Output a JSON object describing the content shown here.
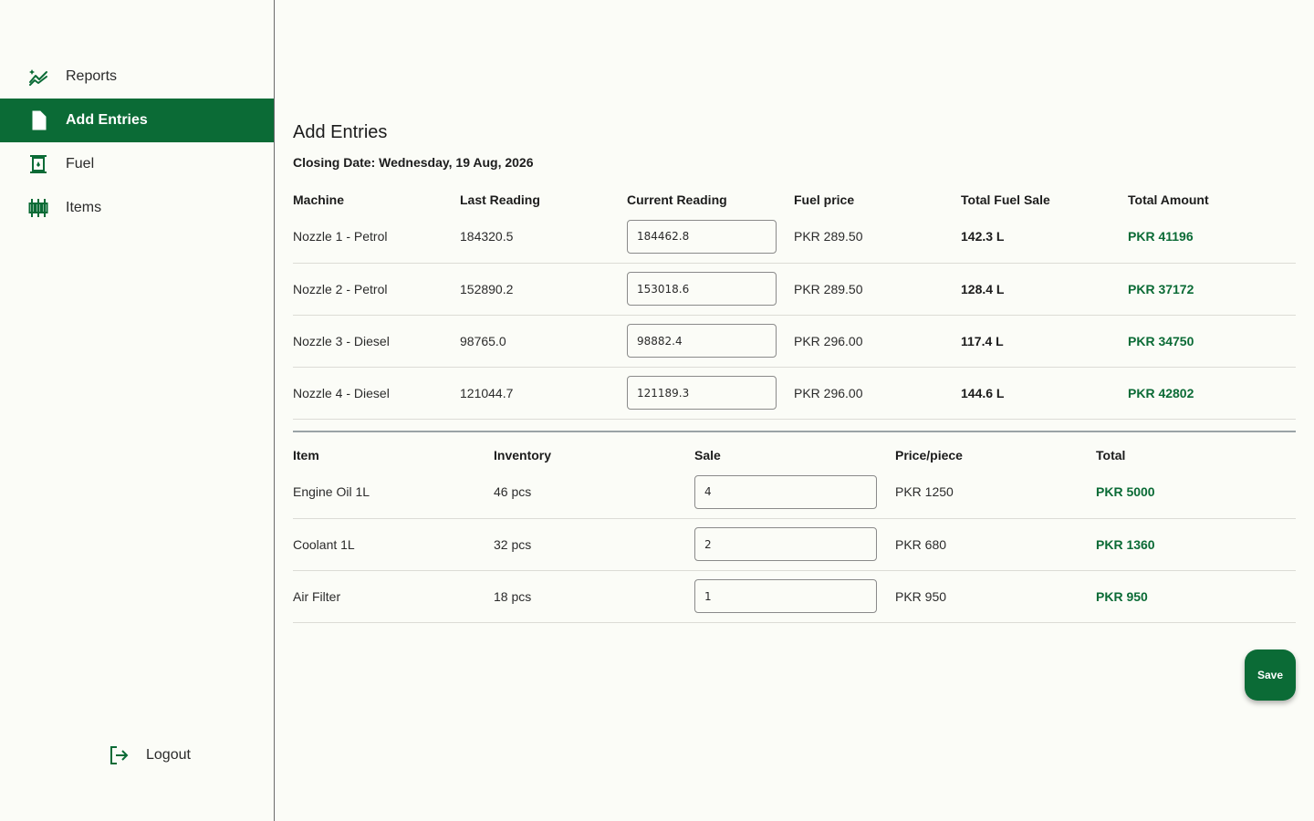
{
  "sidebar": {
    "items": [
      {
        "label": "Reports",
        "icon": "chart-sparkle-icon",
        "active": false
      },
      {
        "label": "Add Entries",
        "icon": "note-add-icon",
        "active": true
      },
      {
        "label": "Fuel",
        "icon": "fuel-pump-icon",
        "active": false
      },
      {
        "label": "Items",
        "icon": "items-bars-icon",
        "active": false
      }
    ],
    "logout_label": "Logout"
  },
  "main": {
    "title": "Add Entries",
    "closing_label": "Closing Date:",
    "closing_date": "Wednesday, 19 Aug, 2026"
  },
  "fuel_table": {
    "headers": [
      "Machine",
      "Last Reading",
      "Current Reading",
      "Fuel price",
      "Total Fuel Sale",
      "Total Amount"
    ],
    "rows": [
      {
        "machine": "Nozzle 1 - Petrol",
        "last": "184320.5",
        "current": "184462.8",
        "price": "PKR 289.50",
        "sale": "142.3 L",
        "amount": "PKR 41196"
      },
      {
        "machine": "Nozzle 2 - Petrol",
        "last": "152890.2",
        "current": "153018.6",
        "price": "PKR 289.50",
        "sale": "128.4 L",
        "amount": "PKR 37172"
      },
      {
        "machine": "Nozzle 3 - Diesel",
        "last": "98765.0",
        "current": "98882.4",
        "price": "PKR 296.00",
        "sale": "117.4 L",
        "amount": "PKR 34750"
      },
      {
        "machine": "Nozzle 4 - Diesel",
        "last": "121044.7",
        "current": "121189.3",
        "price": "PKR 296.00",
        "sale": "144.6 L",
        "amount": "PKR 42802"
      }
    ]
  },
  "item_table": {
    "headers": [
      "Item",
      "Inventory",
      "Sale",
      "Price/piece",
      "Total"
    ],
    "rows": [
      {
        "item": "Engine Oil 1L",
        "inventory": "46 pcs",
        "sale": "4",
        "price": "PKR 1250",
        "total": "PKR 5000"
      },
      {
        "item": "Coolant 1L",
        "inventory": "32 pcs",
        "sale": "2",
        "price": "PKR 680",
        "total": "PKR 1360"
      },
      {
        "item": "Air Filter",
        "inventory": "18 pcs",
        "sale": "1",
        "price": "PKR 950",
        "total": "PKR 950"
      }
    ]
  },
  "save_label": "Save",
  "colors": {
    "accent": "#0b6b36",
    "background": "#fbfcf7"
  }
}
